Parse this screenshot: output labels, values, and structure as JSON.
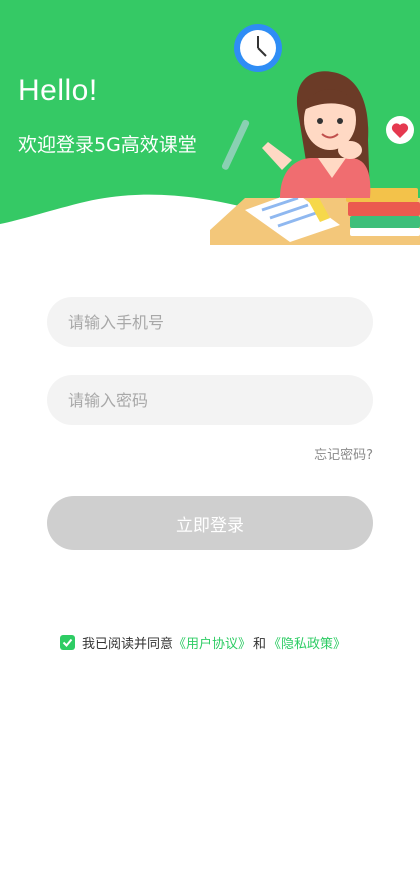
{
  "colors": {
    "brand": "#35c965",
    "accent_link": "#2ecc64",
    "button_disabled": "#cfcfcf"
  },
  "hero": {
    "greeting": "Hello!",
    "subtitle": "欢迎登录5G高效课堂",
    "illustration_icons": [
      "clock-icon",
      "heart-icon",
      "pen-icon",
      "books-icon"
    ]
  },
  "form": {
    "phone_placeholder": "请输入手机号",
    "password_placeholder": "请输入密码",
    "forgot_password": "忘记密码?",
    "login_button": "立即登录"
  },
  "agreement": {
    "checked": true,
    "prefix": "我已阅读并同意",
    "user_agreement": "《用户协议》",
    "conjunction": "和",
    "privacy_policy": "《隐私政策》"
  }
}
